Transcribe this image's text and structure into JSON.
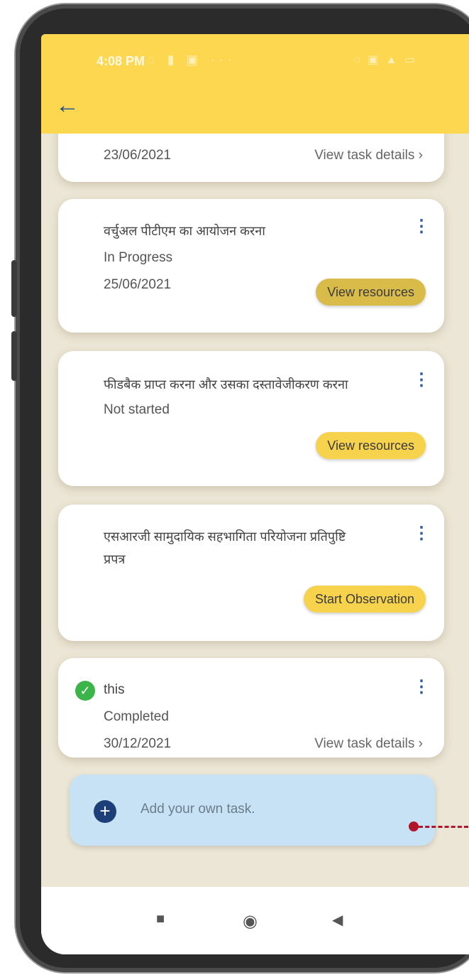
{
  "status": {
    "time": "4:08 PM",
    "left_icons": "◌ ▮ ▣ ···",
    "right_icons": "◌ ▣ ▲ ▭"
  },
  "header": {
    "back_icon": "arrow-left-icon"
  },
  "cards": [
    {
      "date": "23/06/2021",
      "link": "View task details"
    },
    {
      "title": "वर्चुअल पीटीएम का आयोजन करना",
      "status": "In Progress",
      "date": "25/06/2021",
      "button": "View resources"
    },
    {
      "title": "फीडबैक प्राप्त करना और उसका दस्तावेजीकरण करना",
      "status": "Not started",
      "button": "View resources"
    },
    {
      "title_line1": "एसआरजी सामुदायिक सहभागिता परियोजना प्रतिपुष्टि",
      "title_line2": "प्रपत्र",
      "button": "Start Observation"
    },
    {
      "title": "this",
      "status": "Completed",
      "date": "30/12/2021",
      "link": "View task details"
    }
  ],
  "add_task": {
    "label": "Add your own task."
  },
  "navbar": {
    "recent": "■",
    "home": "◉",
    "back": "◀"
  },
  "colors": {
    "header": "#fdd74f",
    "pill": "#f7d24c",
    "accent": "#1f4d8f",
    "add_bg": "#c8e2f5",
    "callout": "#b0162b"
  }
}
